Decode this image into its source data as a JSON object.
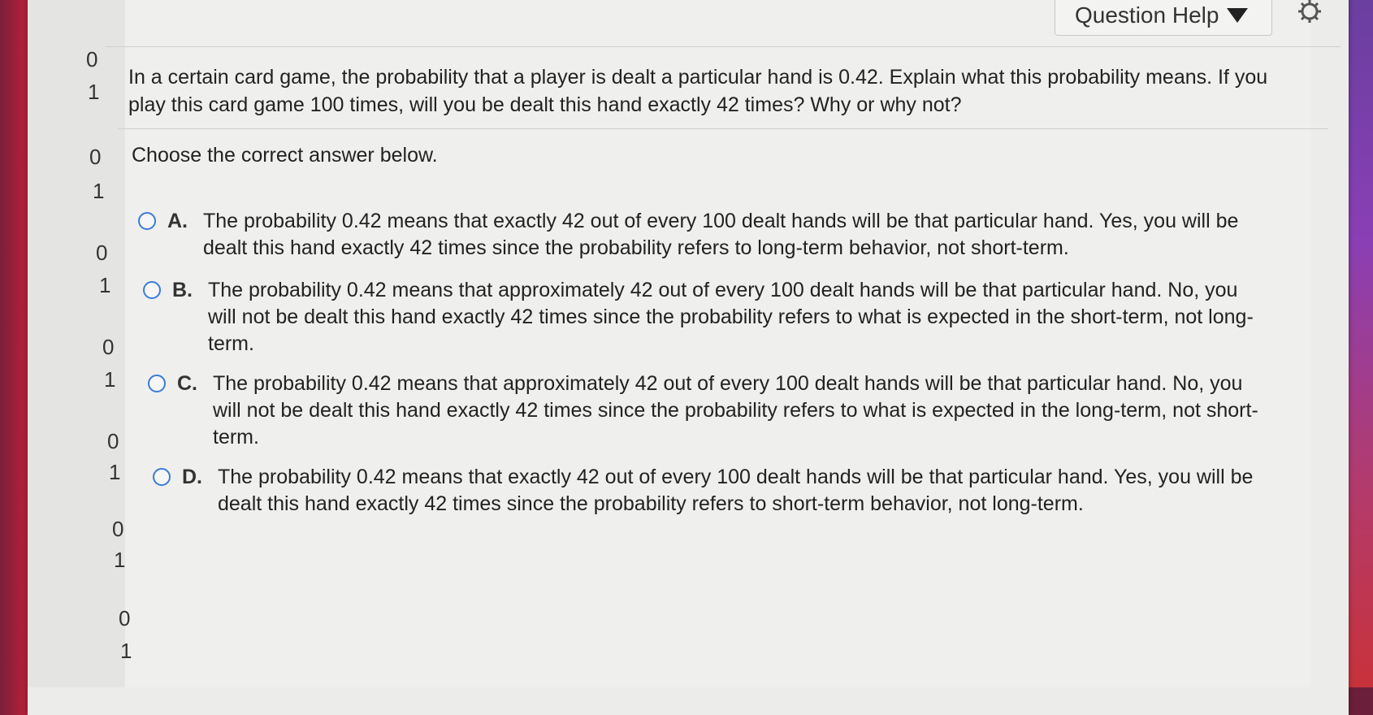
{
  "header": {
    "question_help_label": "Question Help"
  },
  "sidebar": {
    "numbers": [
      "0",
      "1",
      "0",
      "1",
      "0",
      "1",
      "0",
      "1",
      "0",
      "1",
      "0",
      "1",
      "0",
      "1"
    ]
  },
  "question": {
    "text": "In a certain card game, the probability that a player is dealt a particular hand is 0.42. Explain what this probability means. If you play this card game 100 times, will you be dealt this hand exactly 42 times? Why or why not?",
    "prompt": "Choose the correct answer below."
  },
  "choices": [
    {
      "letter": "A.",
      "text": "The probability 0.42 means that exactly 42 out of every 100 dealt hands will be that particular hand. Yes, you will be dealt this hand exactly 42 times since the probability refers to long-term behavior, not short-term."
    },
    {
      "letter": "B.",
      "text": "The probability 0.42 means that approximately 42 out of every 100 dealt hands will be that particular hand. No, you will not be dealt this hand exactly 42 times since the probability refers to what is expected in the short-term, not long-term."
    },
    {
      "letter": "C.",
      "text": "The probability 0.42 means that approximately 42 out of every 100 dealt hands will be that particular hand. No, you will not be dealt this hand exactly 42 times since the probability refers to what is expected in the long-term, not short-term."
    },
    {
      "letter": "D.",
      "text": "The probability 0.42 means that exactly 42 out of every 100 dealt hands will be that particular hand. Yes, you will be dealt this hand exactly 42 times since the probability refers to short-term behavior, not long-term."
    }
  ],
  "colors": {
    "radio_border": "#3a7bd5",
    "page_bg": "#efefed"
  }
}
